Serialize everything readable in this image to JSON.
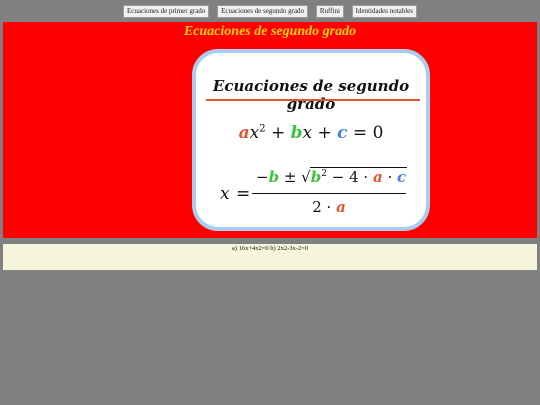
{
  "nav": {
    "buttons": [
      "Ecuaciones de primer grado",
      "Ecuaciones de segundo grado",
      "Ruffini",
      "Identidades notables"
    ]
  },
  "banner": {
    "title": "Ecuaciones de segundo grado",
    "background_color": "#ff0000",
    "title_color": "#ffd700"
  },
  "card": {
    "title": "Ecuaciones de segundo grado",
    "accent_colors": {
      "a": "#e8522a",
      "b": "#3ac43a",
      "c": "#4a7fe0"
    }
  },
  "exercises": {
    "text": "a) 16x+4x2=0 b) 2x2-3x-2=0"
  }
}
